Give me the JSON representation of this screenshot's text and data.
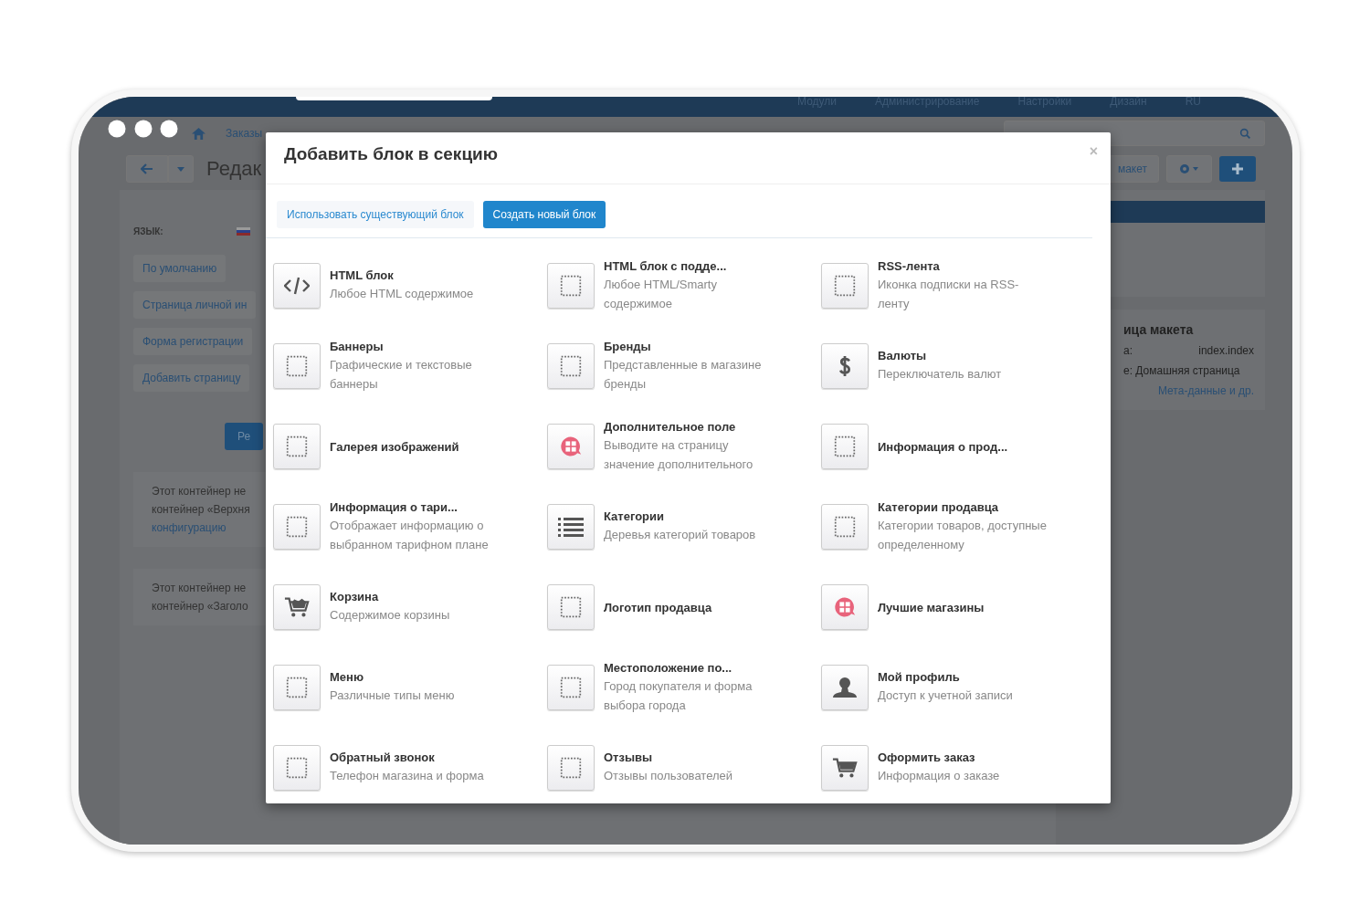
{
  "background": {
    "top_nav": [
      "Модули",
      "Администрирование",
      "Настройки",
      "Дизайн",
      "RU"
    ],
    "menu": [
      "Заказы"
    ],
    "page_title": "Редак",
    "language_label": "ЯЗЫК:",
    "left_buttons": [
      "По умолчанию",
      "Страница личной ин",
      "Форма регистрации",
      "Добавить страницу"
    ],
    "blue_button": "Ре",
    "notes": [
      {
        "lines": [
          "Этот контейнер не",
          "контейнер «Верхня"
        ],
        "link": "конфигурацию"
      },
      {
        "lines": [
          "Этот контейнер не",
          "контейнер «Заголо"
        ]
      }
    ],
    "layout_button": "макет",
    "side_panel": {
      "title": "ица макета",
      "rows": [
        {
          "label": "а:",
          "value": "index.index"
        },
        {
          "label": "е: Домашняя страница",
          "value": ""
        }
      ],
      "link": "Мета-данные и др."
    }
  },
  "modal": {
    "title": "Добавить блок в секцию",
    "close": "×",
    "tabs": [
      {
        "label": "Использовать существующий блок",
        "selected": false
      },
      {
        "label": "Создать новый блок",
        "selected": true
      }
    ],
    "blocks": [
      {
        "title": "HTML блок",
        "description": "Любое HTML содержимое",
        "kind": "code"
      },
      {
        "title": "HTML блок с подде...",
        "description": "Любое HTML/Smarty содержимое",
        "kind": "placeholder"
      },
      {
        "title": "RSS-лента",
        "description": "Иконка подписки на RSS-ленту",
        "kind": "placeholder"
      },
      {
        "title": "Баннеры",
        "description": "Графические и текстовые баннеры",
        "kind": "placeholder"
      },
      {
        "title": "Бренды",
        "description": "Представленные в магазине бренды",
        "kind": "placeholder"
      },
      {
        "title": "Валюты",
        "description": "Переключатель валют",
        "kind": "dollar"
      },
      {
        "title": "Галерея изображений",
        "kind": "placeholder"
      },
      {
        "title": "Дополнительное поле",
        "description": "Выводите на страницу значение дополнительного",
        "kind": "addon"
      },
      {
        "title": "Информация о прод...",
        "kind": "placeholder"
      },
      {
        "title": "Информация о тари...",
        "description": "Отображает информацию о выбранном тарифном плане",
        "kind": "placeholder"
      },
      {
        "title": "Категории",
        "description": "Деревья категорий товаров",
        "kind": "list"
      },
      {
        "title": "Категории продавца",
        "description": "Категории товаров, доступные определенному",
        "kind": "placeholder"
      },
      {
        "title": "Корзина",
        "description": "Содержимое корзины",
        "kind": "full"
      },
      {
        "title": "Логотип продавца",
        "kind": "placeholder"
      },
      {
        "title": "Лучшие магазины",
        "kind": "addon"
      },
      {
        "title": "Меню",
        "description": "Различные типы меню",
        "kind": "placeholder"
      },
      {
        "title": "Местоположение по...",
        "description": "Город покупателя и форма выбора города",
        "kind": "placeholder"
      },
      {
        "title": "Мой профиль",
        "description": "Доступ к учетной записи",
        "kind": "user"
      },
      {
        "title": "Обратный звонок",
        "description": "Телефон магазина и форма",
        "kind": "placeholder"
      },
      {
        "title": "Отзывы",
        "description": "Отзывы пользователей",
        "kind": "placeholder"
      },
      {
        "title": "Оформить заказ",
        "description": "Информация о заказе",
        "kind": "cart"
      }
    ]
  }
}
